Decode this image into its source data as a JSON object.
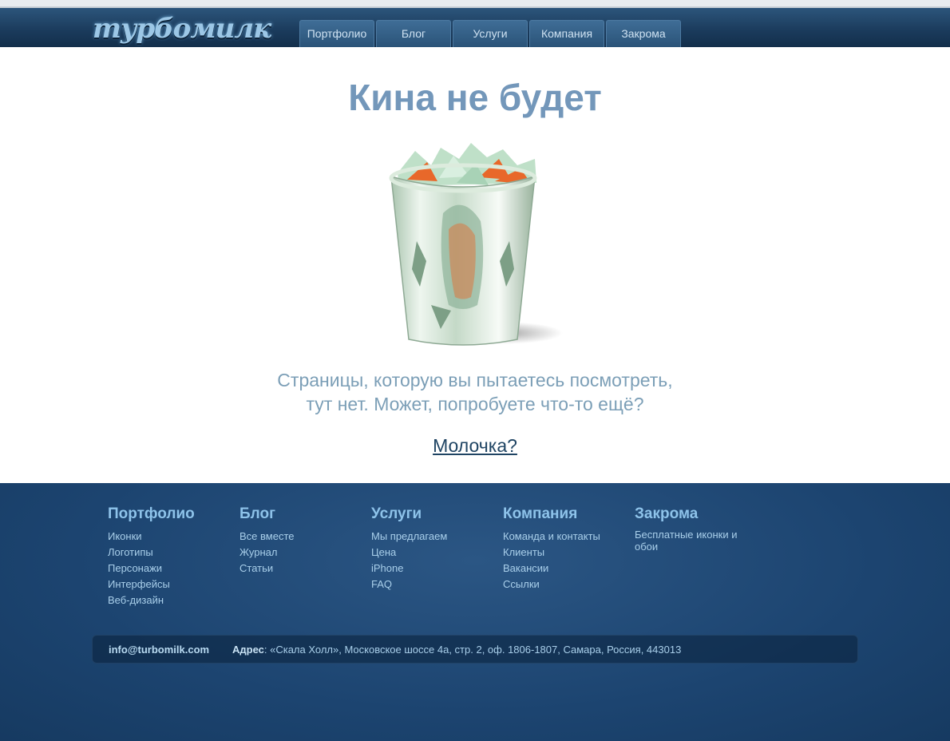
{
  "header": {
    "logo": "турбомилк",
    "nav": [
      "Портфолио",
      "Блог",
      "Услуги",
      "Компания",
      "Закрома"
    ]
  },
  "main": {
    "title": "Кина не будет",
    "message_line1": "Страницы, которую вы пытаетесь посмотреть,",
    "message_line2": "тут нет. Может, попробуете что-то ещё?",
    "milk_link": "Молочка?"
  },
  "footer": {
    "columns": [
      {
        "heading": "Портфолио",
        "links": [
          "Иконки",
          "Логотипы",
          "Персонажи",
          "Интерфейсы",
          "Веб-дизайн"
        ]
      },
      {
        "heading": "Блог",
        "links": [
          "Все вместе",
          "Журнал",
          "Статьи"
        ]
      },
      {
        "heading": "Услуги",
        "links": [
          "Мы предлагаем",
          "Цена",
          "iPhone",
          "FAQ"
        ]
      },
      {
        "heading": "Компания",
        "links": [
          "Команда и контакты",
          "Клиенты",
          "Вакансии",
          "Ссылки"
        ]
      },
      {
        "heading": "Закрома",
        "links": [
          "Бесплатные иконки и обои"
        ]
      }
    ],
    "email": "info@turbomilk.com",
    "address_label": "Адрес",
    "address_text": ": «Скала Холл», Московское шоссе 4а, стр. 2, оф. 1806-1807, Самара, Россия, 443013"
  },
  "colors": {
    "header": "#1a3a5b",
    "footer": "#1c4470",
    "title": "#7397ba",
    "accent_orange": "#e8682a"
  },
  "icons": {
    "illustration": "trash-bin-icon"
  }
}
